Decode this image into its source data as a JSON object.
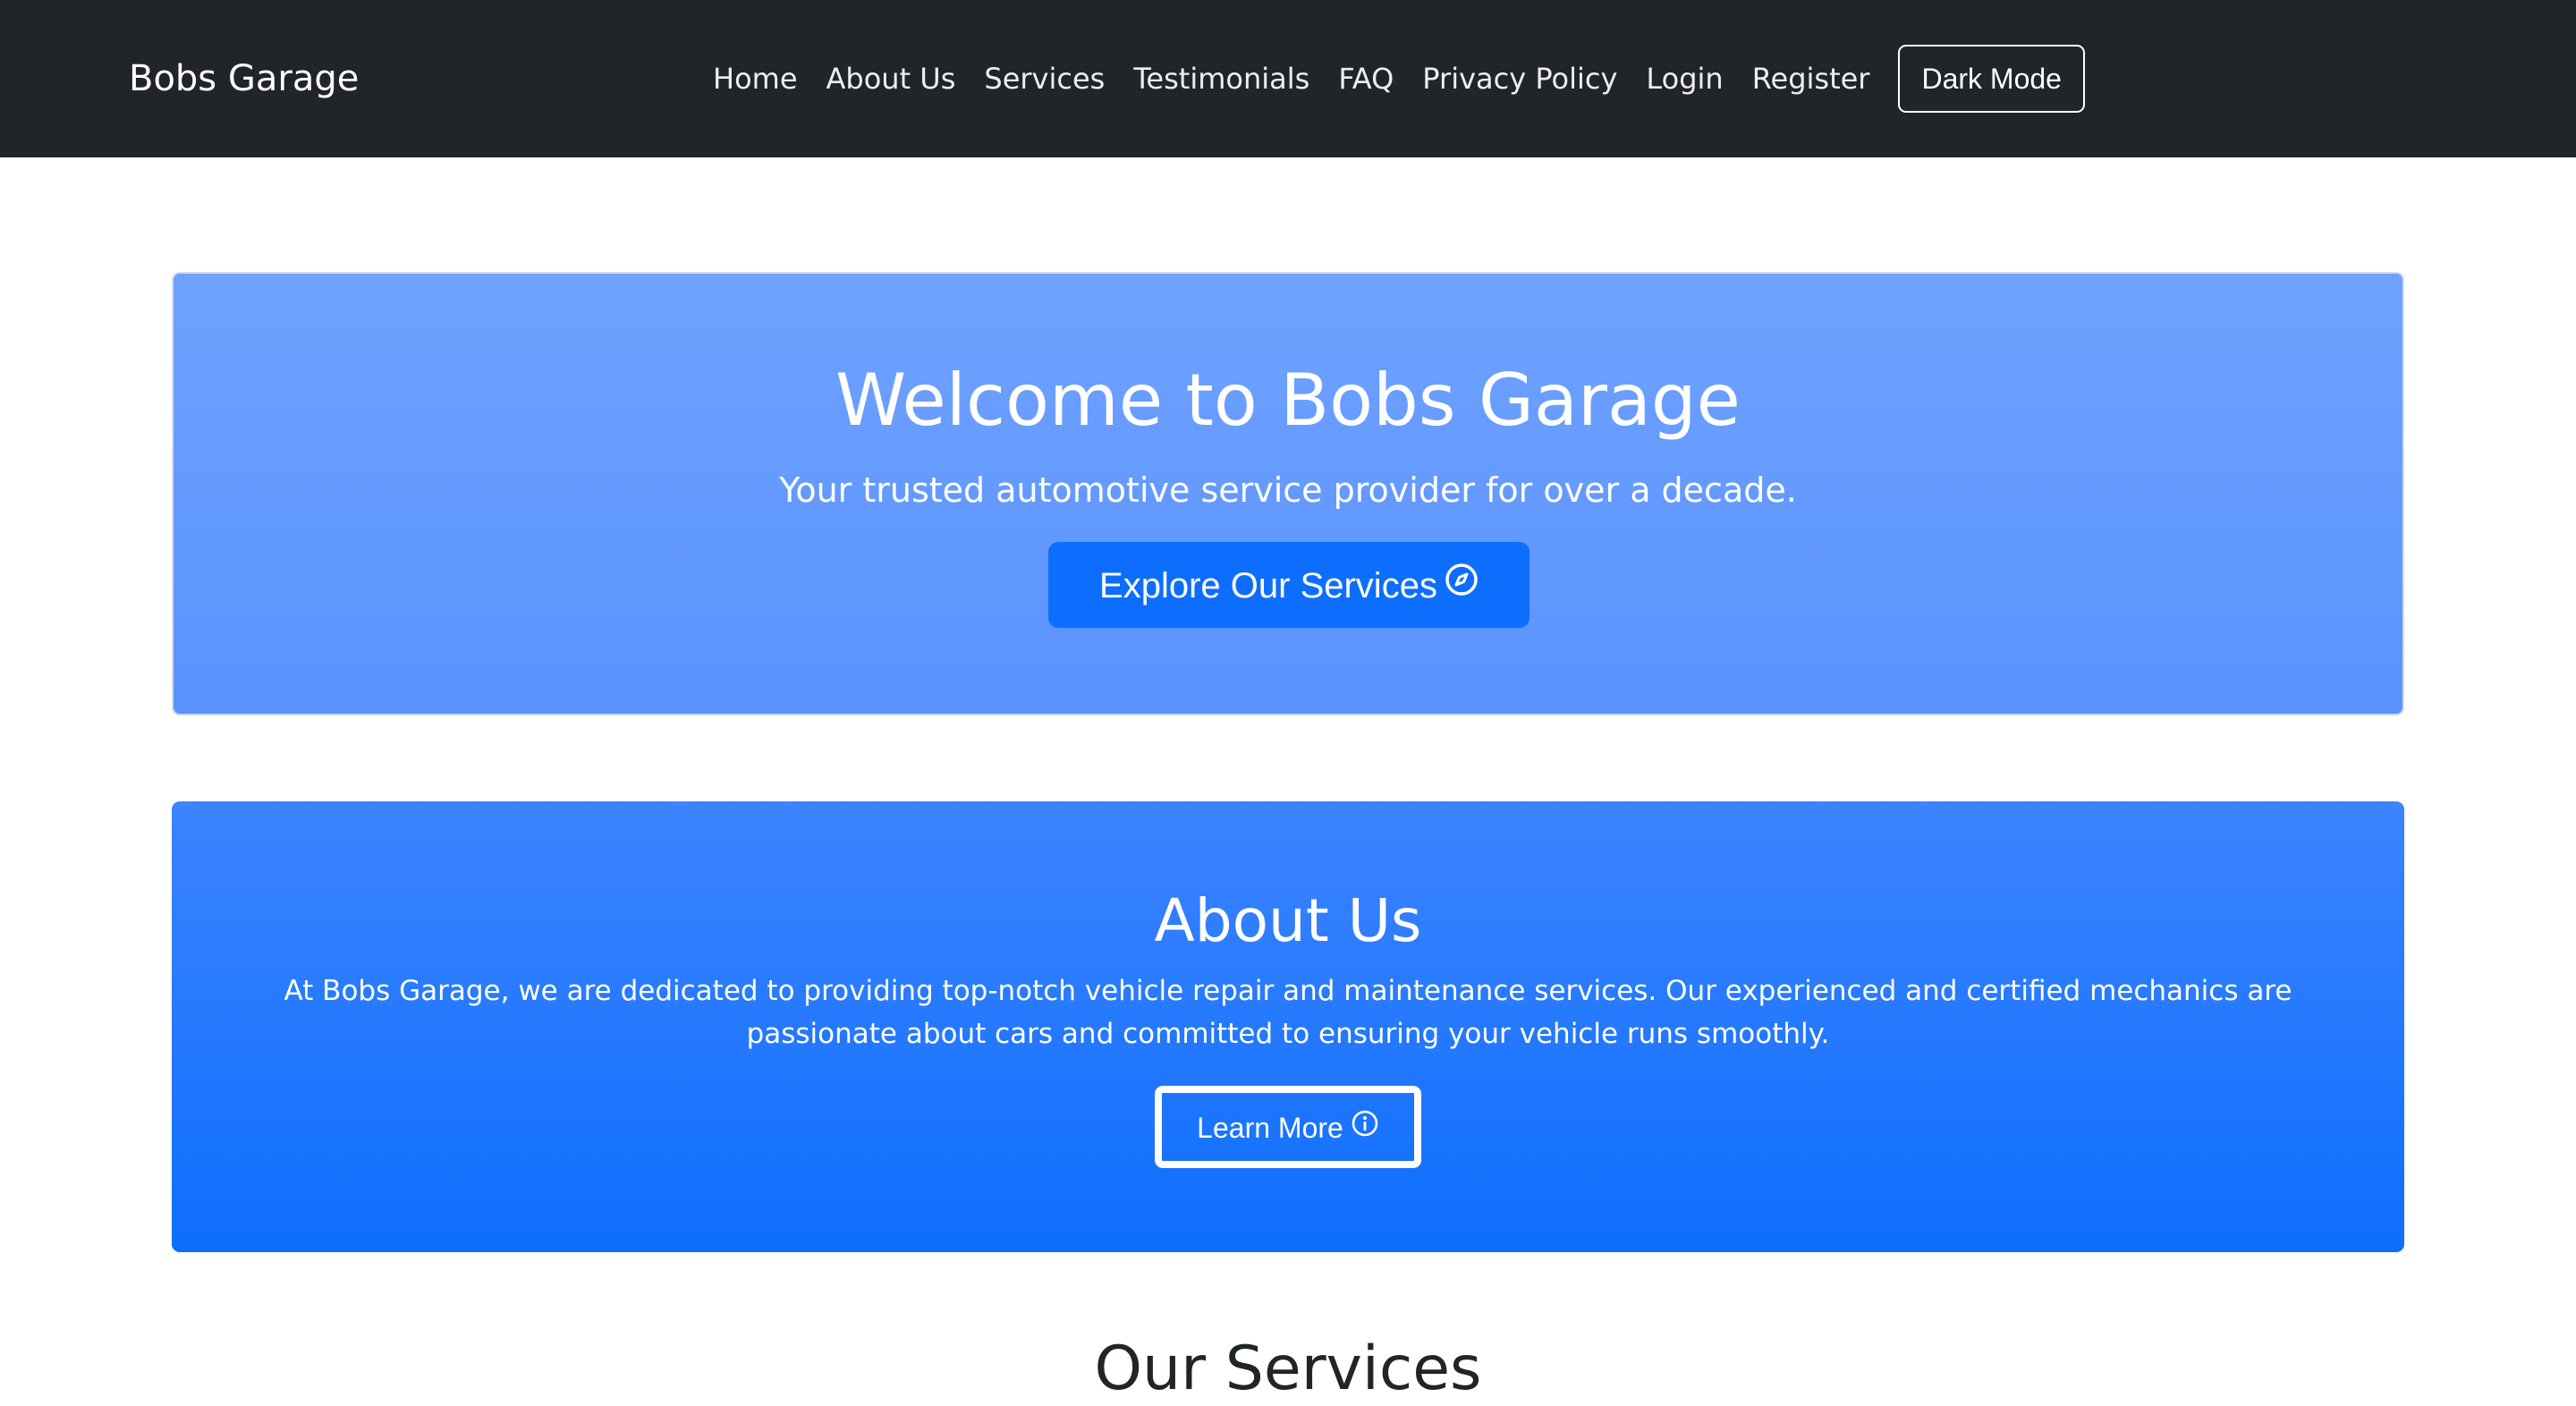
{
  "navbar": {
    "brand": "Bobs Garage",
    "links": [
      "Home",
      "About Us",
      "Services",
      "Testimonials",
      "FAQ",
      "Privacy Policy",
      "Login",
      "Register"
    ],
    "dark_mode_label": "Dark Mode"
  },
  "hero": {
    "title": "Welcome to Bobs Garage",
    "subtitle": "Your trusted automotive service provider for over a decade.",
    "button_label": "Explore Our Services",
    "button_icon": "compass-icon"
  },
  "about": {
    "title": "About Us",
    "text": "At Bobs Garage, we are dedicated to providing top-notch vehicle repair and maintenance services. Our experienced and certified mechanics are passionate about cars and committed to ensuring your vehicle runs smoothly.",
    "button_label": "Learn More",
    "button_icon": "info-circle-icon"
  },
  "services": {
    "heading": "Our Services"
  },
  "colors": {
    "navbar_bg": "#212529",
    "hero_bg": "#6fa2ff",
    "primary": "#0d6efd",
    "about_bg": "#3d84ff"
  }
}
